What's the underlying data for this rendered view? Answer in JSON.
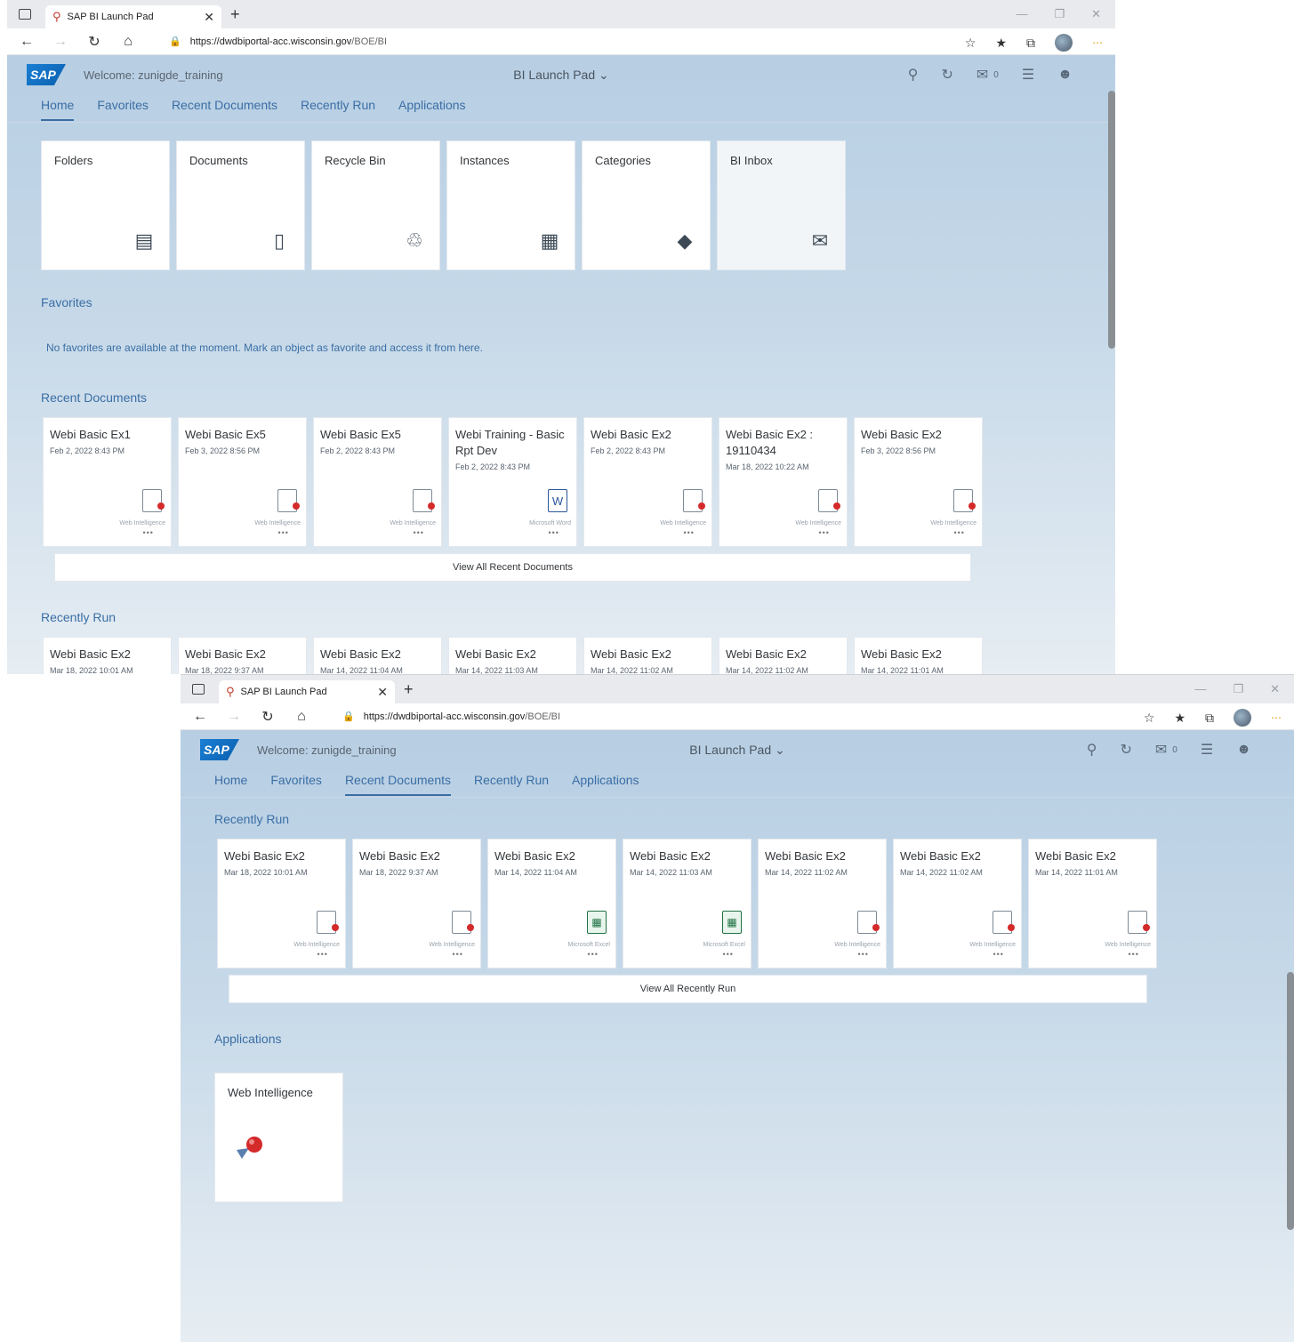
{
  "browser": {
    "tab_title": "SAP BI Launch Pad",
    "url_host": "https://dwdbiportal-acc.wisconsin.gov",
    "url_path": "/BOE/BI"
  },
  "shell": {
    "welcome": "Welcome: zunigde_training",
    "title": "BI Launch Pad ⌄",
    "notif_count": "0"
  },
  "nav": [
    "Home",
    "Favorites",
    "Recent Documents",
    "Recently Run",
    "Applications"
  ],
  "home_tiles": [
    {
      "label": "Folders",
      "icon": "folder-icon",
      "glyph": "▤"
    },
    {
      "label": "Documents",
      "icon": "document-icon",
      "glyph": "▯"
    },
    {
      "label": "Recycle Bin",
      "icon": "trash-icon",
      "glyph": "♲"
    },
    {
      "label": "Instances",
      "icon": "calendar-icon",
      "glyph": "▦"
    },
    {
      "label": "Categories",
      "icon": "categories-icon",
      "glyph": "◆"
    },
    {
      "label": "BI Inbox",
      "icon": "mail-icon",
      "glyph": "✉"
    }
  ],
  "favorites": {
    "title": "Favorites",
    "empty_message": "No favorites are available at the moment. Mark an object as favorite and access it from here."
  },
  "recent_documents": {
    "title": "Recent Documents",
    "view_all": "View All Recent Documents",
    "items": [
      {
        "name": "Webi Basic Ex1",
        "date": "Feb 2, 2022 8:43 PM",
        "type": "Web Intelligence",
        "kind": "webi"
      },
      {
        "name": "Webi Basic Ex5",
        "date": "Feb 3, 2022 8:56 PM",
        "type": "Web Intelligence",
        "kind": "webi"
      },
      {
        "name": "Webi Basic Ex5",
        "date": "Feb 2, 2022 8:43 PM",
        "type": "Web Intelligence",
        "kind": "webi"
      },
      {
        "name": "Webi Training - Basic Rpt Dev",
        "date": "Feb 2, 2022 8:43 PM",
        "type": "Microsoft Word",
        "kind": "word"
      },
      {
        "name": "Webi Basic Ex2",
        "date": "Feb 2, 2022 8:43 PM",
        "type": "Web Intelligence",
        "kind": "webi"
      },
      {
        "name": "Webi Basic Ex2 : 19110434",
        "date": "Mar 18, 2022 10:22 AM",
        "type": "Web Intelligence",
        "kind": "webi"
      },
      {
        "name": "Webi Basic Ex2",
        "date": "Feb 3, 2022 8:56 PM",
        "type": "Web Intelligence",
        "kind": "webi"
      }
    ]
  },
  "recently_run": {
    "title": "Recently Run",
    "view_all": "View All Recently Run",
    "items": [
      {
        "name": "Webi Basic Ex2",
        "date": "Mar 18, 2022 10:01 AM",
        "type": "Web Intelligence",
        "kind": "webi"
      },
      {
        "name": "Webi Basic Ex2",
        "date": "Mar 18, 2022 9:37 AM",
        "type": "Web Intelligence",
        "kind": "webi"
      },
      {
        "name": "Webi Basic Ex2",
        "date": "Mar 14, 2022 11:04 AM",
        "type": "Microsoft Excel",
        "kind": "excel"
      },
      {
        "name": "Webi Basic Ex2",
        "date": "Mar 14, 2022 11:03 AM",
        "type": "Microsoft Excel",
        "kind": "excel"
      },
      {
        "name": "Webi Basic Ex2",
        "date": "Mar 14, 2022 11:02 AM",
        "type": "Web Intelligence",
        "kind": "webi"
      },
      {
        "name": "Webi Basic Ex2",
        "date": "Mar 14, 2022 11:02 AM",
        "type": "Web Intelligence",
        "kind": "webi"
      },
      {
        "name": "Webi Basic Ex2",
        "date": "Mar 14, 2022 11:01 AM",
        "type": "Web Intelligence",
        "kind": "webi"
      }
    ],
    "partial_dates": [
      "Mar 18, 2022 10:01 AM",
      "Mar 18, 2022 9:37 AM",
      "Mar 14, 2022 11:04 AM",
      "Mar 14, 2022 11:03 AM",
      "Mar 14, 2022 11:02 AM",
      "Mar 14, 2022 11:02 AM",
      "Mar 14, 2022 11:01 AM"
    ]
  },
  "applications": {
    "title": "Applications",
    "items": [
      {
        "name": "Web Intelligence"
      }
    ]
  },
  "colors": {
    "accent": "#3a6ea5",
    "webi_red": "#d42a2a",
    "excel_green": "#217346",
    "word_blue": "#2a5699"
  }
}
